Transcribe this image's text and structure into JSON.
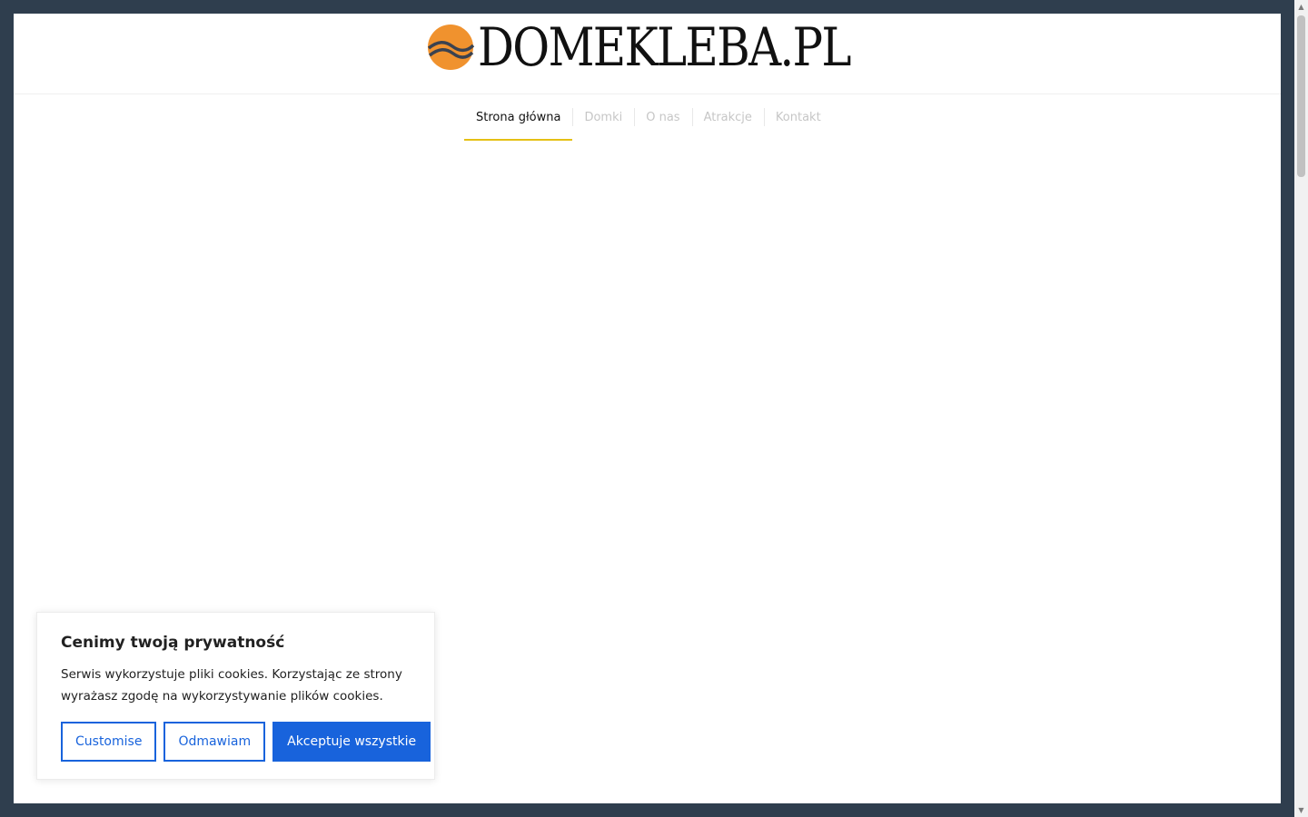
{
  "brand": {
    "logo_text": "DOMEKLEBA.PL",
    "sun_color": "#f0922e",
    "wave_color": "#3a4250"
  },
  "nav": {
    "items": [
      {
        "label": "Strona główna",
        "active": true
      },
      {
        "label": "Domki",
        "active": false
      },
      {
        "label": "O nas",
        "active": false
      },
      {
        "label": "Atrakcje",
        "active": false
      },
      {
        "label": "Kontakt",
        "active": false
      }
    ],
    "accent_color": "#e5c014"
  },
  "cookie_banner": {
    "title": "Cenimy twoją prywatność",
    "text": "Serwis wykorzystuje pliki cookies. Korzystając ze strony wyrażasz zgodę na wykorzystywanie plików cookies.",
    "customise_label": "Customise",
    "reject_label": "Odmawiam",
    "accept_label": "Akceptuje wszystkie",
    "button_color": "#1863dc"
  },
  "scrollbar": {
    "up_icon": "triangle-up",
    "down_icon": "triangle-down"
  }
}
